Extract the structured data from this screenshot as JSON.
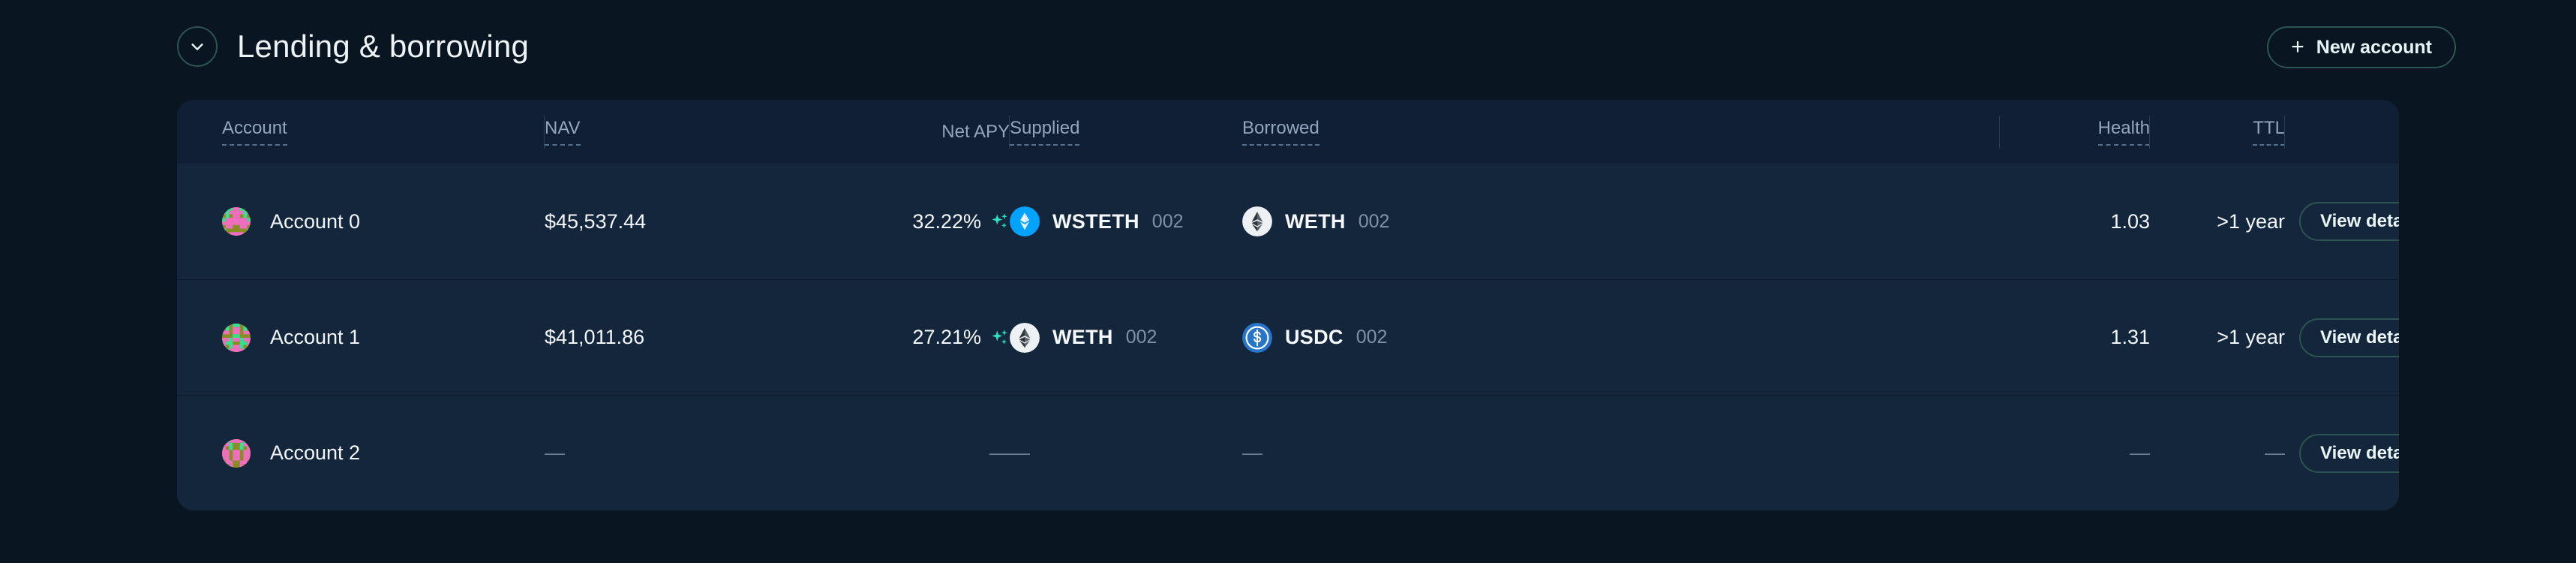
{
  "section": {
    "title": "Lending & borrowing",
    "collapse_icon": "chevron-down-icon",
    "new_account_label": "New account",
    "plus_icon": "plus-icon"
  },
  "table": {
    "columns": [
      {
        "key": "account",
        "label": "Account",
        "align": "left",
        "dashed": true,
        "divider": false
      },
      {
        "key": "nav",
        "label": "NAV",
        "align": "left",
        "dashed": true,
        "divider": true
      },
      {
        "key": "net_apy",
        "label": "Net APY",
        "align": "right",
        "dashed": false,
        "divider": false
      },
      {
        "key": "supplied",
        "label": "Supplied",
        "align": "left",
        "dashed": true,
        "divider": true
      },
      {
        "key": "borrowed",
        "label": "Borrowed",
        "align": "left",
        "dashed": true,
        "divider": false
      },
      {
        "key": "health",
        "label": "Health",
        "align": "right",
        "dashed": true,
        "divider": true
      },
      {
        "key": "ttl",
        "label": "TTL",
        "align": "right",
        "dashed": true,
        "divider": true
      },
      {
        "key": "action",
        "label": "",
        "align": "right",
        "dashed": false,
        "divider": true
      }
    ],
    "empty_placeholder": "—",
    "action_label": "View details",
    "rows": [
      {
        "account": "Account 0",
        "avatar": "blockie-avatar",
        "nav": "$45,537.44",
        "net_apy": "32.22%",
        "apy_icon": "sparkles-icon",
        "supplied": {
          "symbol": "WSTETH",
          "suffix": "002",
          "icon": "wsteth-token-icon"
        },
        "borrowed": {
          "symbol": "WETH",
          "suffix": "002",
          "icon": "weth-token-icon"
        },
        "health": "1.03",
        "ttl": ">1 year",
        "empty": false
      },
      {
        "account": "Account 1",
        "avatar": "blockie-avatar",
        "nav": "$41,011.86",
        "net_apy": "27.21%",
        "apy_icon": "sparkles-icon",
        "supplied": {
          "symbol": "WETH",
          "suffix": "002",
          "icon": "weth-token-icon"
        },
        "borrowed": {
          "symbol": "USDC",
          "suffix": "002",
          "icon": "usdc-token-icon"
        },
        "health": "1.31",
        "ttl": ">1 year",
        "empty": false
      },
      {
        "account": "Account 2",
        "avatar": "blockie-avatar",
        "nav": "—",
        "net_apy": "—",
        "apy_icon": null,
        "supplied": null,
        "borrowed": null,
        "health": "—",
        "ttl": "—",
        "empty": true
      }
    ]
  },
  "colors": {
    "page_bg": "#091521",
    "card_bg": "#14263c",
    "header_bg": "#101f33",
    "accent_teal": "#2c5450",
    "sparkle": "#2ee0bd",
    "muted_text": "#93a6bd",
    "primary_text": "#f2f6f9"
  }
}
